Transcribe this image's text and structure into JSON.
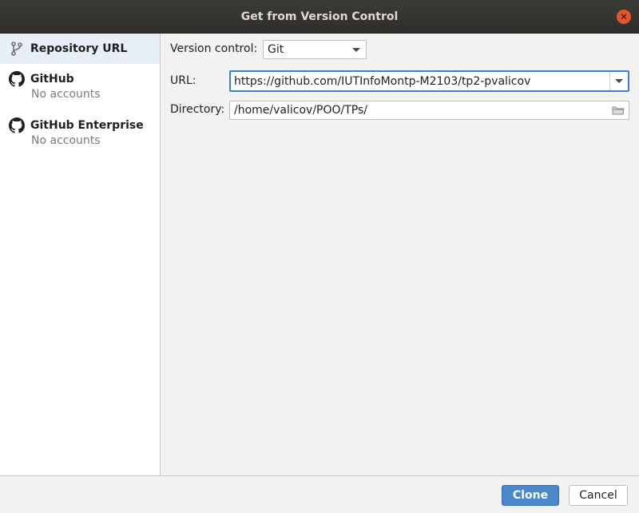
{
  "window": {
    "title": "Get from Version Control"
  },
  "sidebar": {
    "items": [
      {
        "label": "Repository URL",
        "sub": "",
        "icon": "vcs-branch-icon",
        "selected": true
      },
      {
        "label": "GitHub",
        "sub": "No accounts",
        "icon": "github-icon",
        "selected": false
      },
      {
        "label": "GitHub Enterprise",
        "sub": "No accounts",
        "icon": "github-icon",
        "selected": false
      }
    ]
  },
  "form": {
    "version_control_label": "Version control:",
    "version_control_value": "Git",
    "url_label": "URL:",
    "url_value": "https://github.com/IUTInfoMontp-M2103/tp2-pvalicov",
    "directory_label": "Directory:",
    "directory_value": "/home/valicov/POO/TPs/"
  },
  "buttons": {
    "clone": "Clone",
    "cancel": "Cancel"
  },
  "colors": {
    "accent": "#4a88c9",
    "titlebar": "#3c3b37",
    "close": "#e2552d",
    "selection": "#e8eef7"
  }
}
